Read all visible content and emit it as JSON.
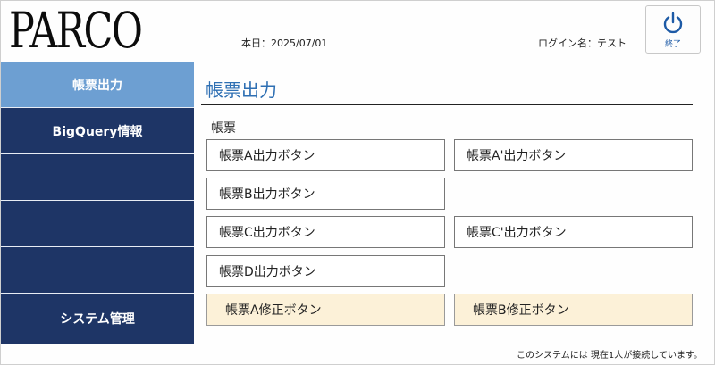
{
  "header": {
    "logo_text": "PARCO",
    "today": "本日：2025/07/01",
    "login": "ログイン名：テスト",
    "exit_label": "終了"
  },
  "sidebar": {
    "items": [
      {
        "label": "帳票出力"
      },
      {
        "label": "BigQuery情報"
      },
      {
        "label": ""
      },
      {
        "label": ""
      },
      {
        "label": ""
      },
      {
        "label": "システム管理"
      }
    ]
  },
  "main": {
    "title": "帳票出力",
    "section_label": "帳票",
    "buttons": {
      "a_output": "帳票A出力ボタン",
      "a2_output": "帳票A'出力ボタン",
      "b_output": "帳票B出力ボタン",
      "c_output": "帳票C出力ボタン",
      "c2_output": "帳票C'出力ボタン",
      "d_output": "帳票D出力ボタン",
      "a_edit": "帳票A修正ボタン",
      "b_edit": "帳票B修正ボタン"
    }
  },
  "footer": {
    "status": "このシステムには 現在1人が接続しています。"
  },
  "colors": {
    "sidebar_bg": "#1e3566",
    "sidebar_active": "#6d9fd2",
    "title_blue": "#2e6fb3",
    "edit_button_bg": "#fcf1d8",
    "exit_icon": "#1d5aa6"
  }
}
